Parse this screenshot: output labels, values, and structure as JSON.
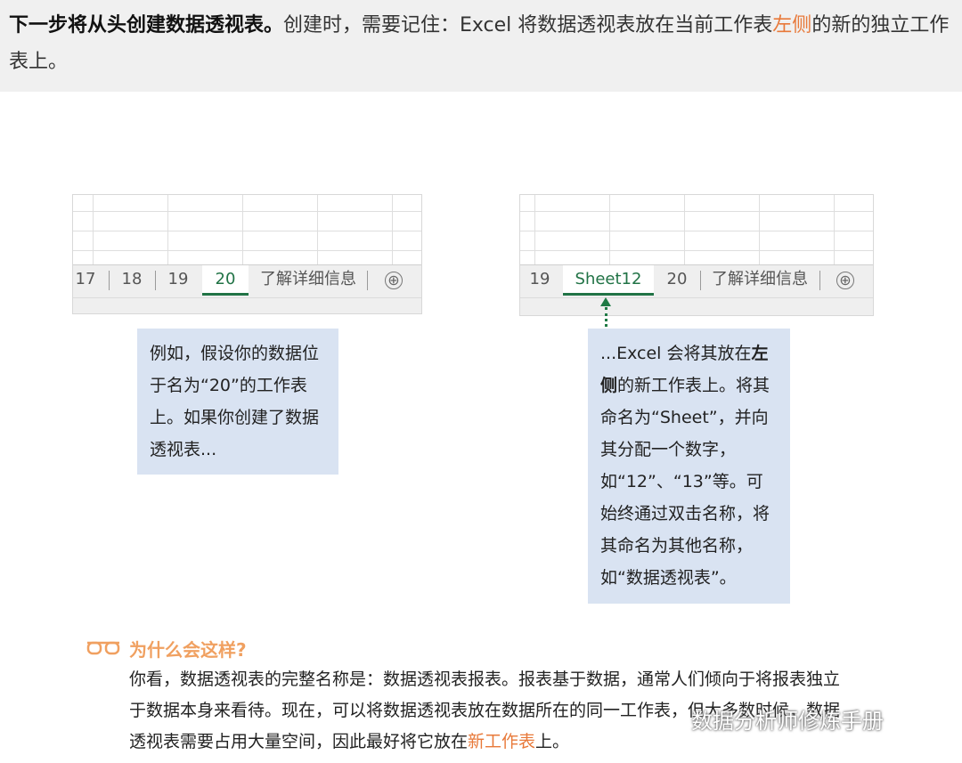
{
  "intro": {
    "bold_text": "下一步将从头创建数据透视表。",
    "text_1": "创建时，需要记住：Excel 将数据透视表放在当前工作表",
    "accent_text": "左侧",
    "text_2": "的新的独立工作表上。"
  },
  "left_sheet": {
    "tabs": [
      "17",
      "18",
      "19",
      "20",
      "了解详细信息"
    ],
    "active_tab": "20",
    "add_tab_glyph": "⊕"
  },
  "right_sheet": {
    "tabs": [
      "19",
      "Sheet12",
      "20",
      "了解详细信息"
    ],
    "active_tab": "Sheet12",
    "add_tab_glyph": "⊕"
  },
  "left_callout": {
    "text": "例如，假设你的数据位于名为“20”的工作表上。如果你创建了数据透视表..."
  },
  "right_callout": {
    "text_1": "...Excel 会将其放在",
    "bold": "左侧",
    "text_2": "的新工作表上。将其命名为“Sheet”，并向其分配一个数字，如“12”、“13”等。可始终通过双击名称，将其命名为其他名称，如“数据透视表”。"
  },
  "why": {
    "icon": "glasses-icon",
    "title": "为什么会这样?",
    "body_1": "你看，数据透视表的完整名称是：数据透视表报表。报表基于数据，通常人们倾向于将报表独立于数据本身来看待。现在，可以将数据透视表放在数据所在的同一工作表，但大多数时候，数据透视表需要占用大量空间，因此最好将它放在",
    "accent": "新工作表",
    "body_2": "上。"
  },
  "watermark": "数据分析师修炼手册",
  "colors": {
    "accent_orange": "#e8793a",
    "excel_green": "#217346",
    "callout_blue": "#d9e3f2",
    "intro_bg": "#f0f0f0"
  }
}
